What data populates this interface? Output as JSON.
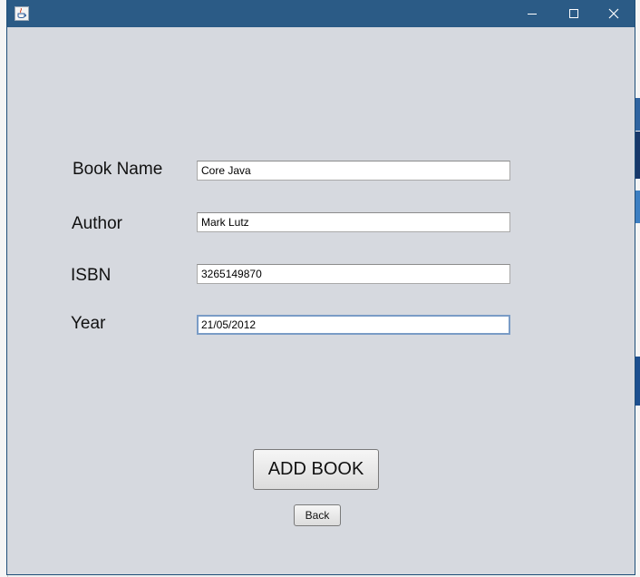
{
  "window": {
    "icon": "java-cup-icon",
    "controls": {
      "minimize_icon": "minimize-icon",
      "maximize_icon": "maximize-icon",
      "close_icon": "close-icon"
    }
  },
  "form": {
    "fields": [
      {
        "label": "Book Name",
        "value": "Core Java"
      },
      {
        "label": "Author",
        "value": "Mark Lutz"
      },
      {
        "label": "ISBN",
        "value": "3265149870"
      },
      {
        "label": "Year",
        "value": "21/05/2012"
      }
    ],
    "add_button_label": "ADD BOOK",
    "back_button_label": "Back"
  },
  "colors": {
    "titlebar": "#2b5b86",
    "window_background": "#d6d9df",
    "focus_border": "#7a9cc6"
  }
}
